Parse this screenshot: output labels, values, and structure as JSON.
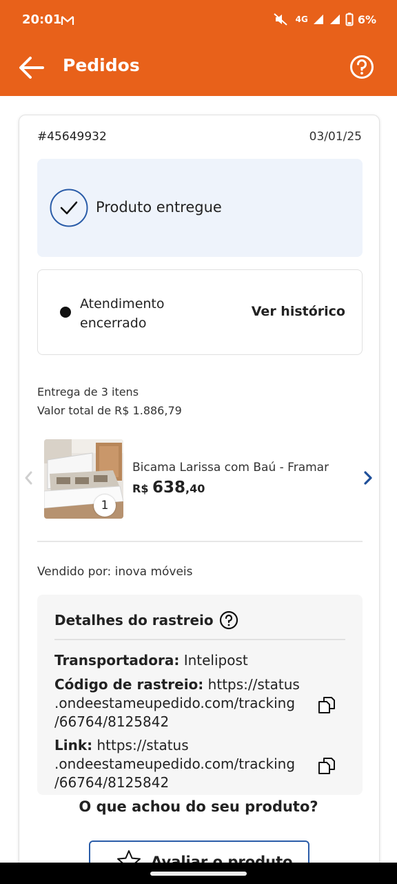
{
  "status_bar": {
    "time": "20:01",
    "network": "4G",
    "battery": "6%",
    "icons": [
      "gmail-icon",
      "mute-icon",
      "signal-icon",
      "signal-icon",
      "battery-icon"
    ]
  },
  "header": {
    "title": "Pedidos",
    "back_icon": "arrow-left-icon",
    "help_icon": "question-circle-icon"
  },
  "order": {
    "id": "#45649932",
    "date": "03/01/25",
    "status": "Produto entregue",
    "support_status": "Atendimento encerrado",
    "history_link": "Ver histórico",
    "delivery_count": "Entrega de 3 itens",
    "total": "Valor total de R$ 1.886,79"
  },
  "product": {
    "name": "Bicama Larissa com Baú - Framar",
    "price_currency": "R$",
    "price_integer": "638",
    "price_cents": ",40",
    "quantity": "1"
  },
  "seller": "Vendido por: inova móveis",
  "tracking": {
    "title": "Detalhes do rastreio",
    "carrier_label": "Transportadora:",
    "carrier_value": "Intelipost",
    "code_label": "Código de rastreio:",
    "code_line1": "https://status",
    "code_line2": ".ondeestameupedido.com/tracking",
    "code_line3": "/66764/8125842",
    "link_label": "Link:",
    "link_line1": "https://status",
    "link_line2": ".ondeestameupedido.com/tracking",
    "link_line3": "/66764/8125842"
  },
  "feedback": {
    "question": "O que achou do seu produto?",
    "button_label": "Avaliar o produto"
  },
  "colors": {
    "brand_orange": "#e8611a",
    "accent_blue": "#2a5ca8",
    "status_bg": "#eef3fb"
  }
}
